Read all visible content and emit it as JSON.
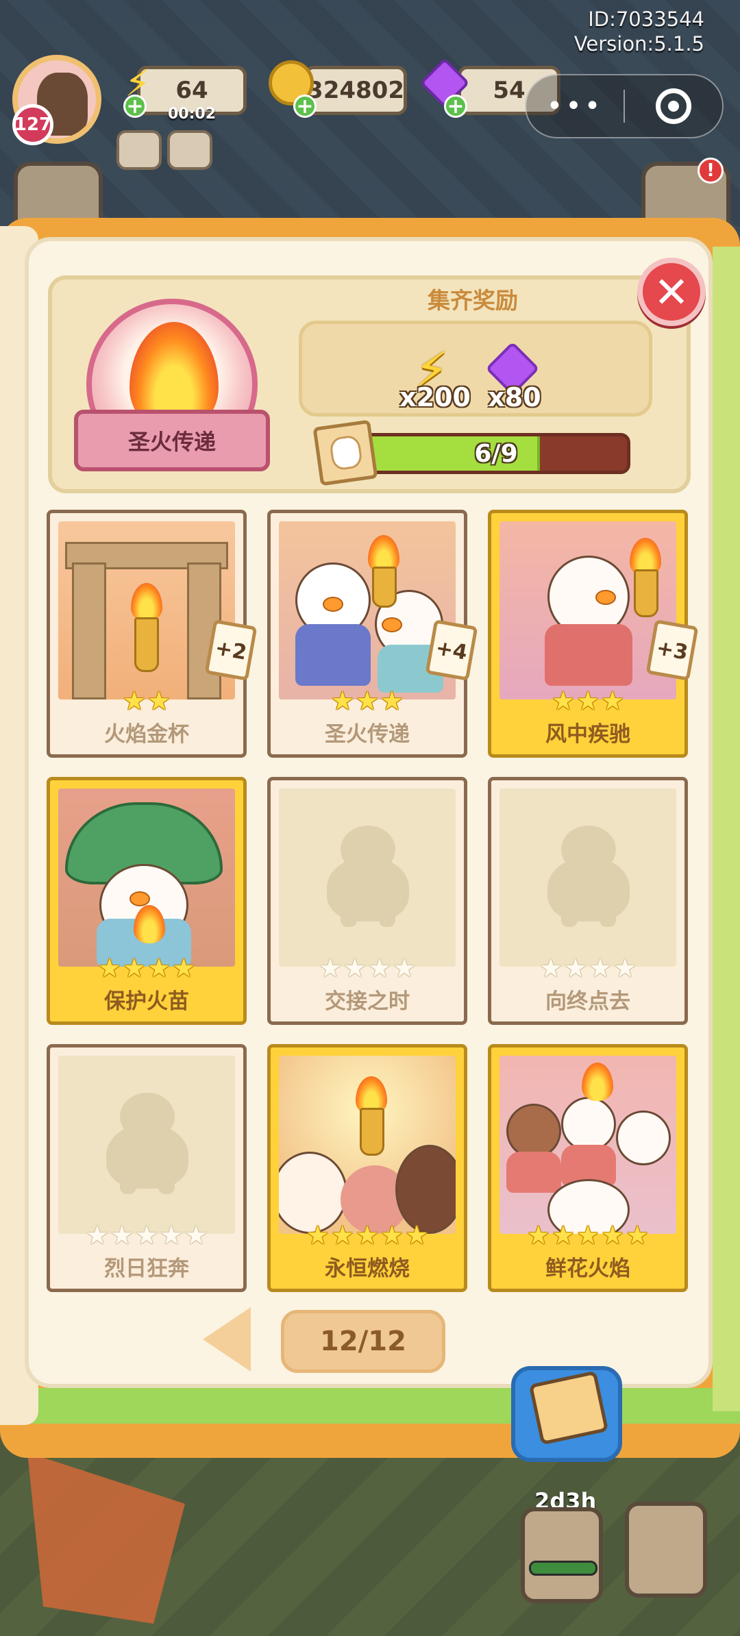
{
  "hud": {
    "id_text": "ID:7033544",
    "version_text": "Version:5.1.5",
    "player_level": "127",
    "energy": {
      "value": "64",
      "timer": "00:02"
    },
    "coins": "324802",
    "gems": "54",
    "capsule_more": "•••"
  },
  "album": {
    "set_badge": "圣火传递",
    "reward_title": "集齐奖励",
    "rewards": [
      {
        "icon": "lightning-bolt-icon",
        "qty": "x200"
      },
      {
        "icon": "purple-gem-icon",
        "qty": "x80"
      }
    ],
    "progress": {
      "collected": 6,
      "total": 9,
      "label": "6/9",
      "fraction": 0.667
    },
    "close_symbol": "✕",
    "cards": [
      {
        "name": "火焰金杯",
        "stars": 2,
        "max_stars": 2,
        "collected": true,
        "gold": false,
        "dup": "+2",
        "art": "arch"
      },
      {
        "name": "圣火传递",
        "stars": 3,
        "max_stars": 3,
        "collected": true,
        "gold": false,
        "dup": "+4",
        "art": "pass"
      },
      {
        "name": "风中疾驰",
        "stars": 3,
        "max_stars": 3,
        "collected": true,
        "gold": true,
        "dup": "+3",
        "art": "run"
      },
      {
        "name": "保护火苗",
        "stars": 4,
        "max_stars": 4,
        "collected": true,
        "gold": true,
        "dup": "",
        "art": "leaf"
      },
      {
        "name": "交接之时",
        "stars": 0,
        "max_stars": 4,
        "collected": false,
        "gold": false,
        "dup": "",
        "art": "empty"
      },
      {
        "name": "向终点去",
        "stars": 0,
        "max_stars": 4,
        "collected": false,
        "gold": false,
        "dup": "",
        "art": "empty"
      },
      {
        "name": "烈日狂奔",
        "stars": 0,
        "max_stars": 5,
        "collected": false,
        "gold": false,
        "dup": "",
        "art": "empty"
      },
      {
        "name": "永恒燃烧",
        "stars": 5,
        "max_stars": 5,
        "collected": true,
        "gold": true,
        "dup": "",
        "art": "crowd"
      },
      {
        "name": "鲜花火焰",
        "stars": 5,
        "max_stars": 5,
        "collected": true,
        "gold": true,
        "dup": "",
        "art": "flowers"
      }
    ],
    "pagination": {
      "label": "12/12"
    }
  },
  "bottom": {
    "event_timer": "2d3h"
  },
  "colors": {
    "book_cover": "#f0a53c",
    "page_bg": "#fbf4e2",
    "gold_card": "#ffd23b",
    "close_red": "#e5484d",
    "progress_fill": "#a5de3f",
    "progress_track": "#8a3a2a"
  }
}
